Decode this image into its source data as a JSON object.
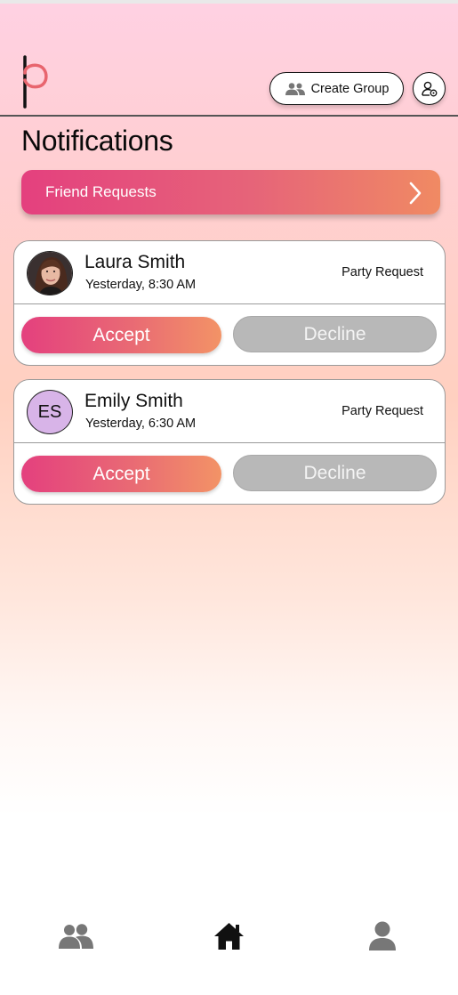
{
  "header": {
    "create_group_label": "Create Group"
  },
  "page_title": "Notifications",
  "friend_requests_label": "Friend Requests",
  "notifications": [
    {
      "name": "Laura Smith",
      "time": "Yesterday, 8:30 AM",
      "type": "Party Request",
      "avatar": "photo",
      "accept_label": "Accept",
      "decline_label": "Decline"
    },
    {
      "name": "Emily Smith",
      "initials": "ES",
      "time": "Yesterday, 6:30 AM",
      "type": "Party Request",
      "avatar": "initials",
      "accept_label": "Accept",
      "decline_label": "Decline"
    }
  ],
  "bottom_nav": {
    "items": [
      {
        "icon": "groups-icon"
      },
      {
        "icon": "home-icon"
      },
      {
        "icon": "person-icon"
      }
    ]
  },
  "colors": {
    "accent_start": "#e4407e",
    "accent_end": "#f08a63",
    "decline_gray": "#b8b8b8"
  }
}
